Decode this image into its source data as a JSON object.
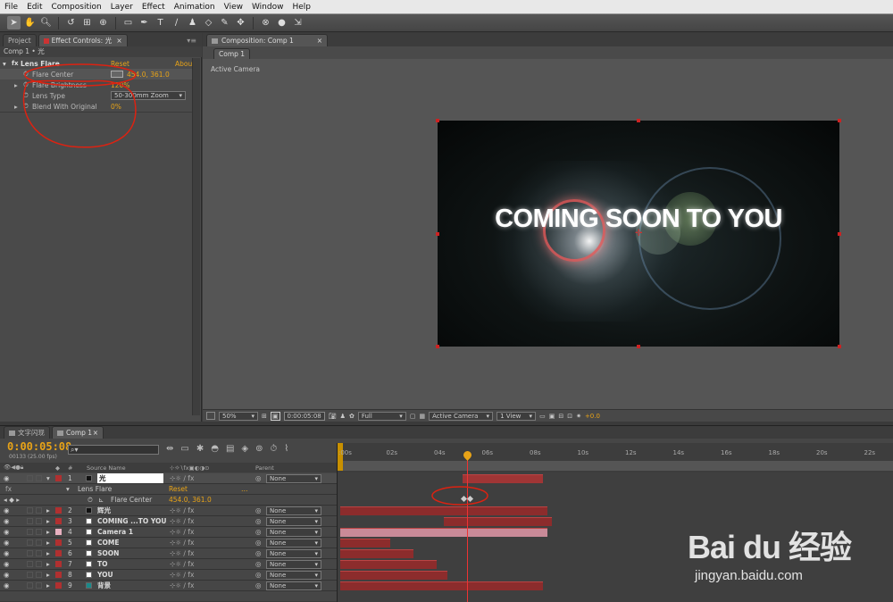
{
  "menu": [
    "File",
    "Edit",
    "Composition",
    "Layer",
    "Effect",
    "Animation",
    "View",
    "Window",
    "Help"
  ],
  "left_panel": {
    "tab_project": "Project",
    "tab_effect": "Effect Controls: 光",
    "subheader": "Comp 1 • 光"
  },
  "effect": {
    "name": "Lens Flare",
    "reset": "Reset",
    "about": "Abou",
    "props": [
      {
        "label": "Flare Center",
        "value": "454.0, 361.0"
      },
      {
        "label": "Flare Brightness",
        "value": "120%"
      },
      {
        "label": "Lens Type",
        "value": "50-300mm Zoom"
      },
      {
        "label": "Blend With Original",
        "value": "0%"
      }
    ]
  },
  "comp_panel": {
    "tab": "Composition: Comp 1",
    "subtab": "Comp 1",
    "view_label": "Active Camera",
    "canvas_text": "COMING SOON TO YOU"
  },
  "comp_footer": {
    "zoom": "50%",
    "timecode": "0:00:05:08",
    "resolution": "Full",
    "camera": "Active Camera",
    "views": "1 View",
    "exposure": "+0.0"
  },
  "timeline": {
    "tab1": "文字闪现",
    "tab2": "Comp 1",
    "timecode": "0:00:05:08",
    "frames": "00133 (25.00 fps)",
    "search": "",
    "col_source": "Source Name",
    "col_parent": "Parent",
    "col_num": "#",
    "ticks": [
      ":00s",
      "02s",
      "04s",
      "06s",
      "08s",
      "10s",
      "12s",
      "14s",
      "16s",
      "18s",
      "20s",
      "22s"
    ],
    "sub_effect": "Lens Flare",
    "sub_reset": "Reset",
    "sub_prop": "Flare Center",
    "sub_value": "454.0, 361.0",
    "layers": [
      {
        "num": "1",
        "name": "光",
        "parent": "None",
        "color": "#b03030",
        "label": "#111"
      },
      {
        "num": "2",
        "name": "辉光",
        "parent": "None",
        "color": "#b03030",
        "label": "#111"
      },
      {
        "num": "3",
        "name": "COMING ...TO YOU",
        "parent": "None",
        "color": "#b03030",
        "label": "#fff"
      },
      {
        "num": "4",
        "name": "Camera 1",
        "parent": "None",
        "color": "#e8b0c0",
        "label": "#fff"
      },
      {
        "num": "5",
        "name": "COME",
        "parent": "None",
        "color": "#b03030",
        "label": "#fff"
      },
      {
        "num": "6",
        "name": "SOON",
        "parent": "None",
        "color": "#b03030",
        "label": "#fff"
      },
      {
        "num": "7",
        "name": "TO",
        "parent": "None",
        "color": "#b03030",
        "label": "#fff"
      },
      {
        "num": "8",
        "name": "YOU",
        "parent": "None",
        "color": "#b03030",
        "label": "#fff"
      },
      {
        "num": "9",
        "name": "背景",
        "parent": "None",
        "color": "#b03030",
        "label": "#1a8a8a"
      }
    ]
  },
  "watermark": {
    "brand": "Bai du 经验",
    "url": "jingyan.baidu.com"
  }
}
